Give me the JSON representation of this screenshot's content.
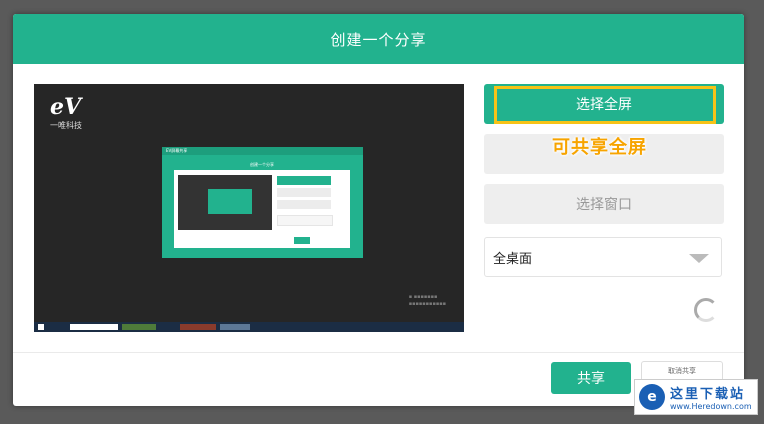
{
  "dialog": {
    "title": "创建一个分享"
  },
  "preview": {
    "logo_mark": "eV",
    "logo_text": "一唯科技",
    "inner_title": "EV屏幕共享",
    "inner_dialog_title": "创建一个分享"
  },
  "options": {
    "fullscreen_label": "选择全屏",
    "region_label": "",
    "window_label": "选择窗口",
    "tooltip": "可共享全屏"
  },
  "desktop_select": {
    "selected": "全桌面"
  },
  "footer": {
    "share_label": "共享",
    "cancel_label": "取消共享"
  },
  "site_watermark": {
    "cn": "这里下载站",
    "url": "www.Heredown.com",
    "icon": "e"
  },
  "colors": {
    "accent": "#22b28e",
    "highlight": "#f7c317",
    "tooltip": "#f7a400"
  }
}
